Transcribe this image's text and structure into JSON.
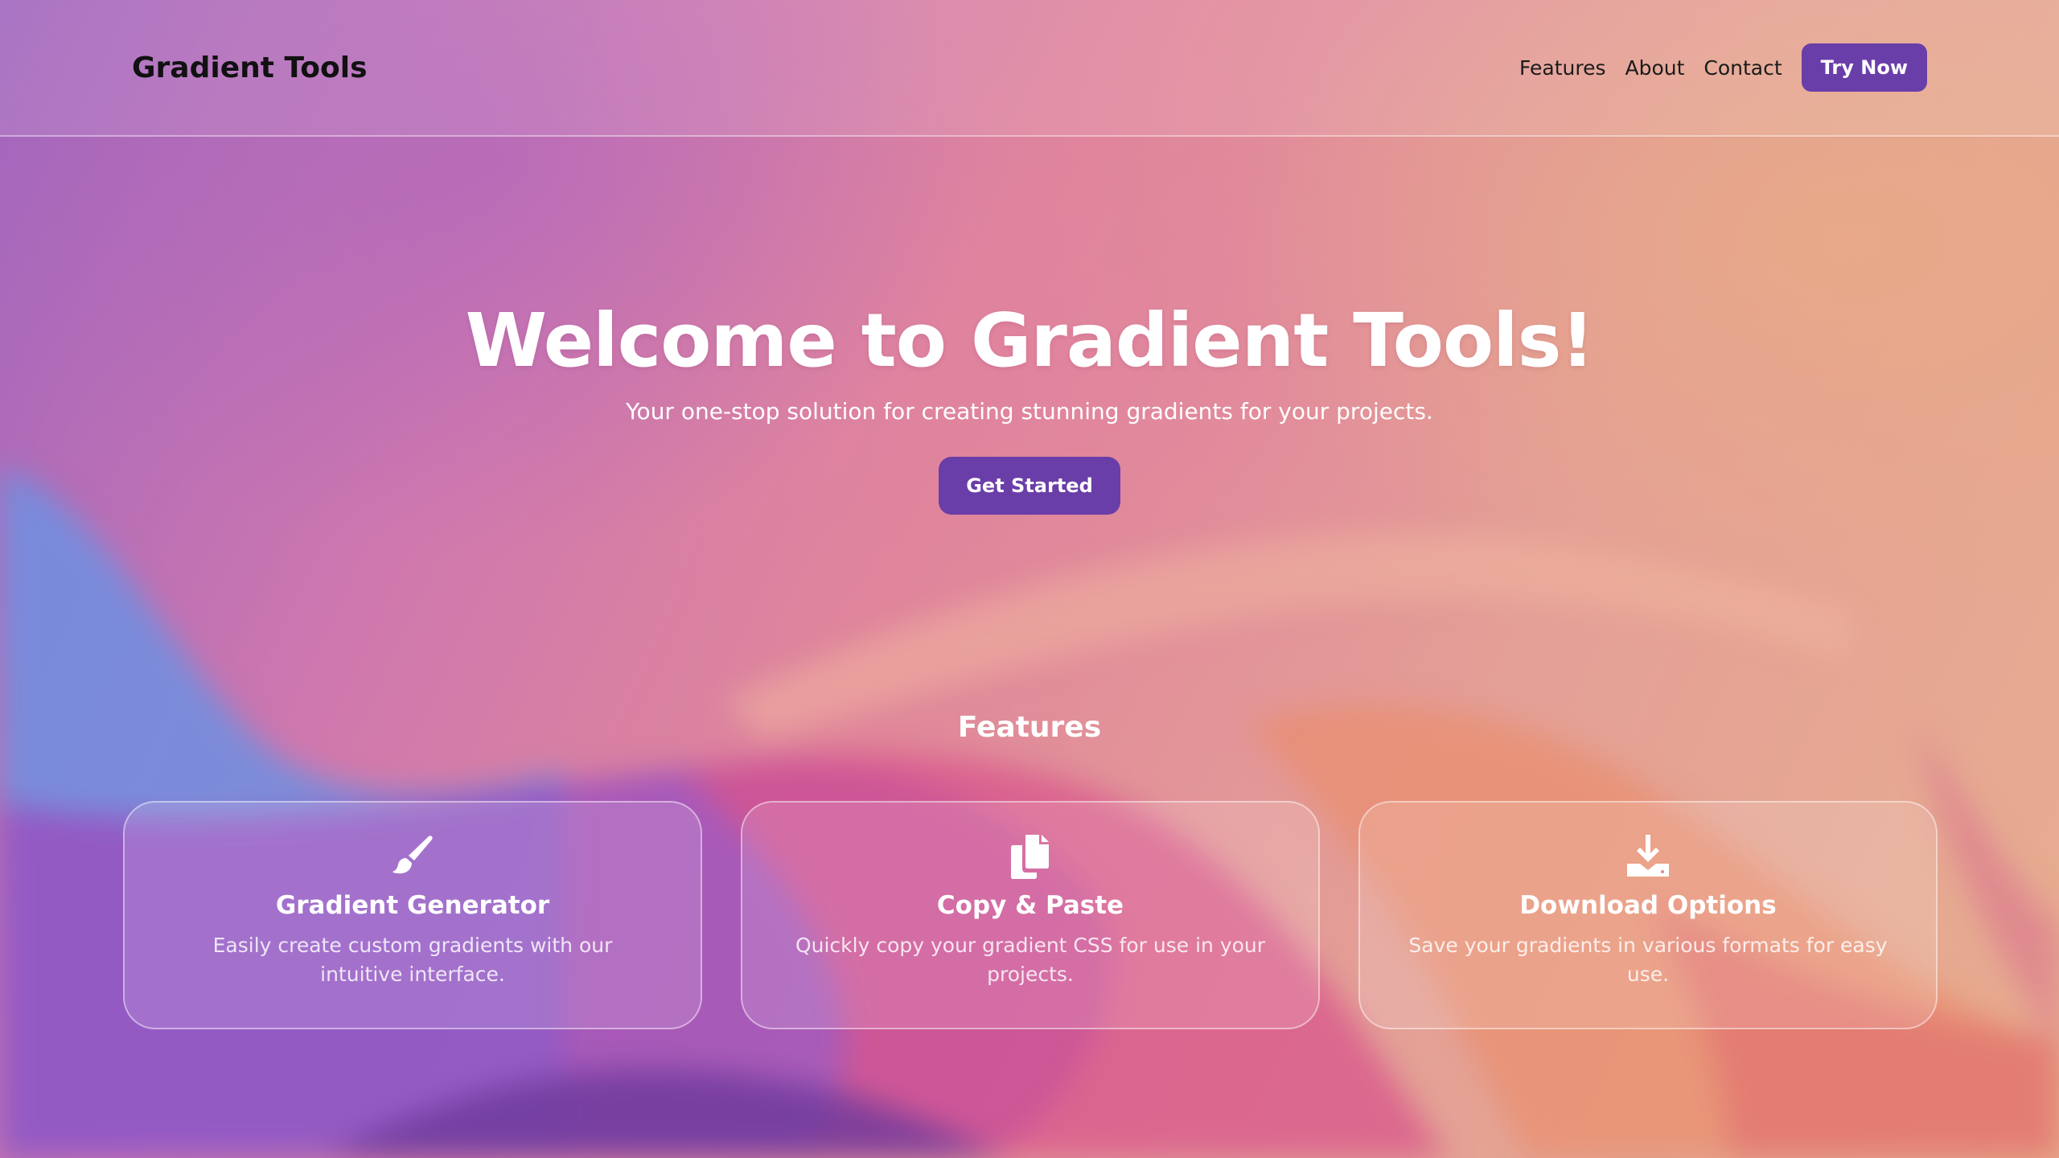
{
  "header": {
    "brand": "Gradient Tools",
    "nav": [
      "Features",
      "About",
      "Contact"
    ],
    "cta_label": "Try Now"
  },
  "hero": {
    "title": "Welcome to Gradient Tools!",
    "subtitle": "Your one-stop solution for creating stunning gradients for your projects.",
    "cta_label": "Get Started"
  },
  "features": {
    "heading": "Features",
    "cards": [
      {
        "icon": "paintbrush-icon",
        "title": "Gradient Generator",
        "description": "Easily create custom gradients with our intuitive interface."
      },
      {
        "icon": "copy-icon",
        "title": "Copy & Paste",
        "description": "Quickly copy your gradient CSS for use in your projects."
      },
      {
        "icon": "download-icon",
        "title": "Download Options",
        "description": "Save your gradients in various formats for easy use."
      }
    ]
  },
  "colors": {
    "accent": "#6a3ea8",
    "text_light": "#ffffff",
    "text_dark": "#111111"
  }
}
